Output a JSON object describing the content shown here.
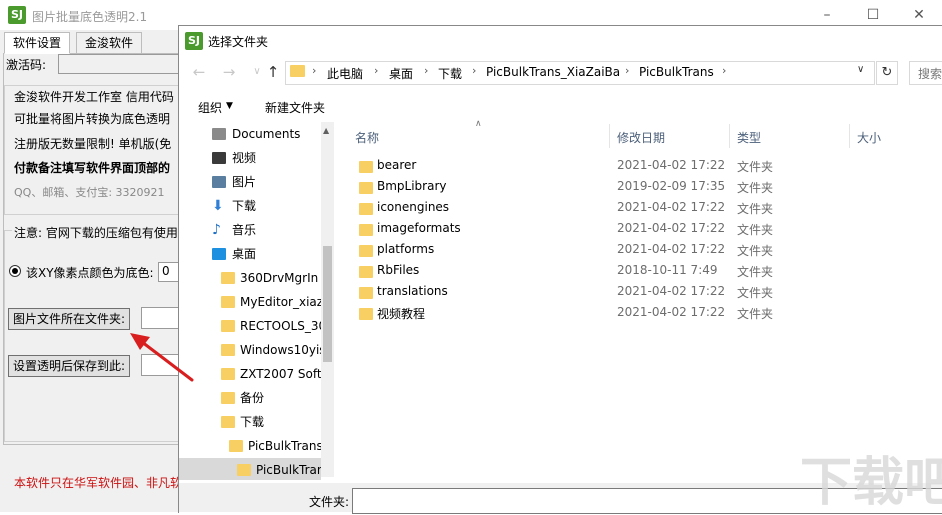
{
  "bg_app": {
    "icon_text": "SJ",
    "title": "图片批量底色透明2.1",
    "tabs": [
      "软件设置",
      "金浚软件"
    ],
    "activation_label": "激活码:",
    "info_lines": [
      "金浚软件开发工作室  信用代码",
      "可批量将图片转换为底色透明",
      "注册版无数量限制! 单机版(免",
      "付款备注填写软件界面顶部的",
      "QQ、邮箱、支付宝: 3320921"
    ],
    "note": "注意: 官网下载的压缩包有使用",
    "radio_label": "该XY像素点颜色为底色:",
    "radio_value": "0",
    "btn_folder": "图片文件所在文件夹:",
    "btn_save": "设置透明后保存到此:",
    "footer": "本软件只在华军软件园、非凡软"
  },
  "dialog": {
    "icon_text": "SJ",
    "title": "选择文件夹",
    "breadcrumb": [
      "此电脑",
      "桌面",
      "下载",
      "PicBulkTrans_XiaZaiBa",
      "PicBulkTrans"
    ],
    "search_placeholder": "搜索",
    "organize_label": "组织",
    "new_folder_label": "新建文件夹",
    "nav_items": [
      {
        "label": "Documents",
        "icon": "documents-icon"
      },
      {
        "label": "视频",
        "icon": "video-icon"
      },
      {
        "label": "图片",
        "icon": "pictures-icon"
      },
      {
        "label": "下载",
        "icon": "download-icon"
      },
      {
        "label": "音乐",
        "icon": "music-icon"
      },
      {
        "label": "桌面",
        "icon": "desktop-icon"
      },
      {
        "label": "360DrvMgrIn",
        "icon": "folder-icon"
      },
      {
        "label": "MyEditor_xiaz",
        "icon": "folder-icon"
      },
      {
        "label": "RECTOOLS_30",
        "icon": "folder-icon"
      },
      {
        "label": "Windows10yis",
        "icon": "folder-icon"
      },
      {
        "label": "ZXT2007 Soft",
        "icon": "folder-icon"
      },
      {
        "label": "备份",
        "icon": "folder-icon"
      },
      {
        "label": "下载",
        "icon": "folder-icon"
      },
      {
        "label": "PicBulkTrans",
        "icon": "folder-icon"
      },
      {
        "label": "PicBulkTran",
        "icon": "folder-icon"
      }
    ],
    "columns": [
      "名称",
      "修改日期",
      "类型",
      "大小"
    ],
    "rows": [
      {
        "name": "bearer",
        "date": "2021-04-02 17:22",
        "type": "文件夹"
      },
      {
        "name": "BmpLibrary",
        "date": "2019-02-09 17:35",
        "type": "文件夹"
      },
      {
        "name": "iconengines",
        "date": "2021-04-02 17:22",
        "type": "文件夹"
      },
      {
        "name": "imageformats",
        "date": "2021-04-02 17:22",
        "type": "文件夹"
      },
      {
        "name": "platforms",
        "date": "2021-04-02 17:22",
        "type": "文件夹"
      },
      {
        "name": "RbFiles",
        "date": "2018-10-11 7:49",
        "type": "文件夹"
      },
      {
        "name": "translations",
        "date": "2021-04-02 17:22",
        "type": "文件夹"
      },
      {
        "name": "视频教程",
        "date": "2021-04-02 17:22",
        "type": "文件夹"
      }
    ],
    "folder_label": "文件夹:"
  },
  "colors": {
    "folder": "#f7cf63",
    "app_icon": "#4a9a2e",
    "annotation_arrow": "#d81e1e",
    "footer_text": "#cc1010"
  }
}
